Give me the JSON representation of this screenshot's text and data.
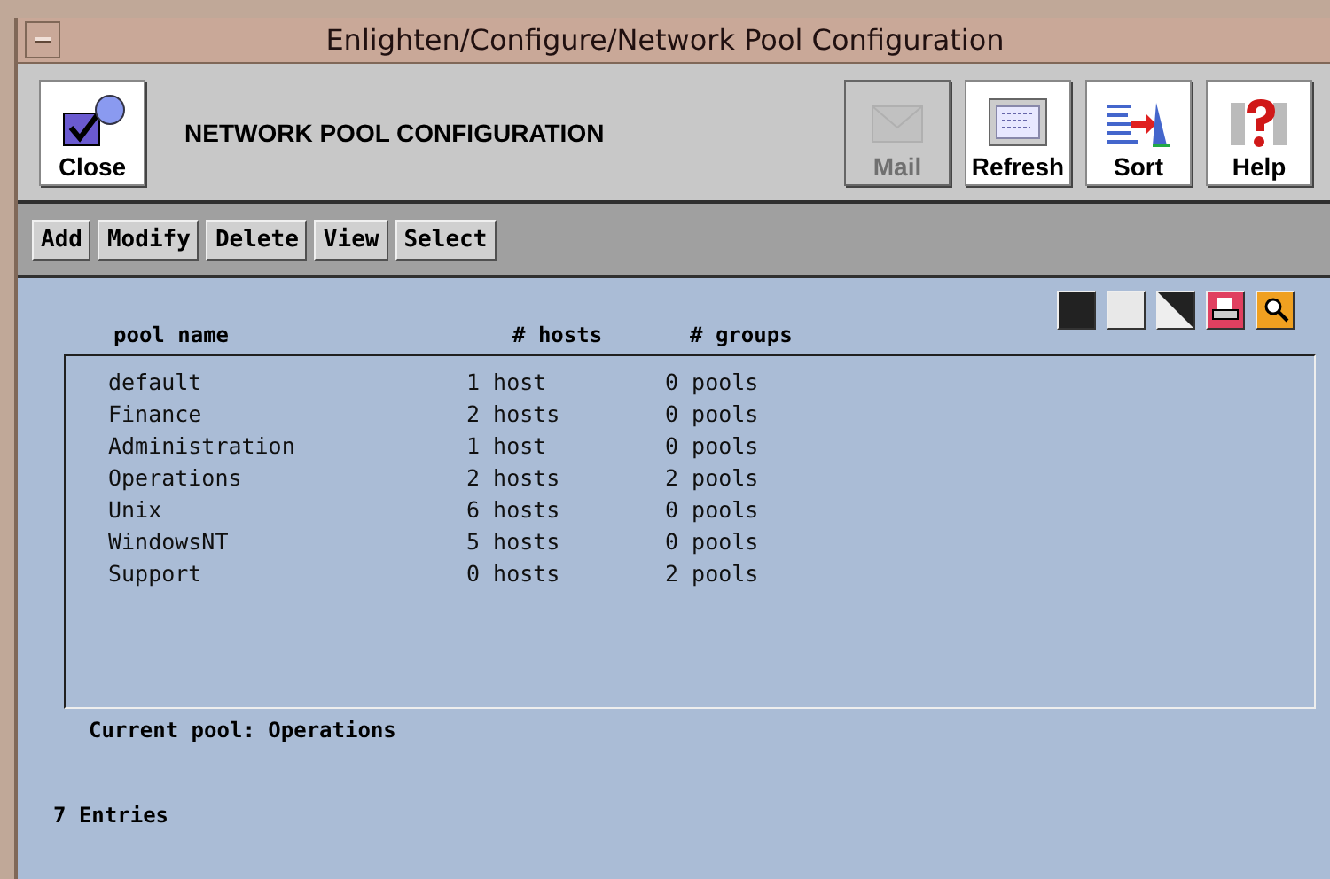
{
  "window": {
    "title": "Enlighten/Configure/Network Pool Configuration"
  },
  "header": {
    "title": "NETWORK POOL CONFIGURATION",
    "left_button": {
      "kind": "close",
      "label": "Close",
      "disabled": false
    },
    "buttons": [
      {
        "kind": "mail",
        "label": "Mail",
        "disabled": true
      },
      {
        "kind": "refresh",
        "label": "Refresh",
        "disabled": false
      },
      {
        "kind": "sort",
        "label": "Sort",
        "disabled": false
      },
      {
        "kind": "help",
        "label": "Help",
        "disabled": false
      }
    ]
  },
  "actions": [
    "Add",
    "Modify",
    "Delete",
    "View",
    "Select"
  ],
  "view_tools": [
    {
      "kind": "dark"
    },
    {
      "kind": "light"
    },
    {
      "kind": "split"
    },
    {
      "kind": "print"
    },
    {
      "kind": "search"
    }
  ],
  "table": {
    "columns": [
      "pool name",
      "# hosts",
      "# groups"
    ],
    "rows": [
      [
        "default",
        "1 host",
        "0 pools"
      ],
      [
        "Finance",
        "2 hosts",
        "0 pools"
      ],
      [
        "Administration",
        "1 host",
        "0 pools"
      ],
      [
        "Operations",
        "2 hosts",
        "2 pools"
      ],
      [
        "Unix",
        "6 hosts",
        "0 pools"
      ],
      [
        "WindowsNT",
        "5 hosts",
        "0 pools"
      ],
      [
        "Support",
        "0 hosts",
        "2 pools"
      ]
    ]
  },
  "current_pool": "Current pool: Operations",
  "status": "7 Entries"
}
